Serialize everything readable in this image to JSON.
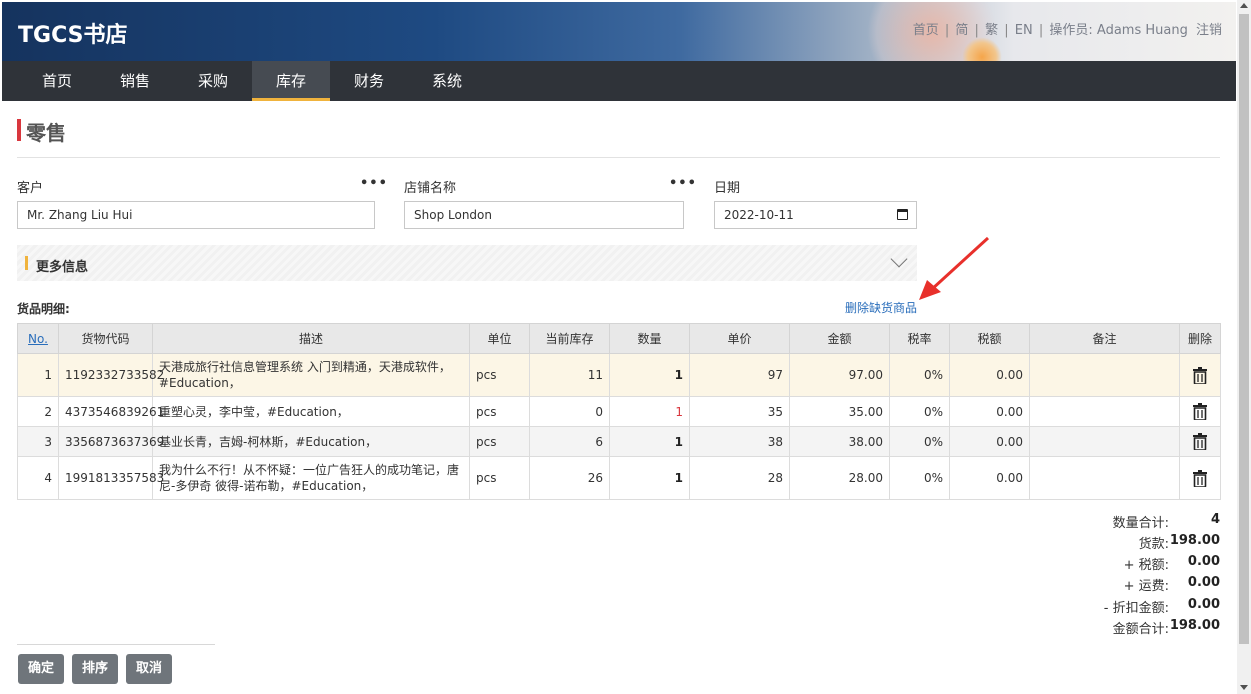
{
  "app": {
    "logo": "TGCS书店",
    "top_links": {
      "home": "首页",
      "simplified": "简",
      "traditional": "繁",
      "english": "EN",
      "operator_label": "操作员: ",
      "operator_name": "Adams Huang",
      "logout": "注销",
      "sep": "|"
    }
  },
  "nav": {
    "items": [
      "首页",
      "销售",
      "采购",
      "库存",
      "财务",
      "系统"
    ],
    "active": "库存"
  },
  "page": {
    "title": "零售"
  },
  "form": {
    "customer_label": "客户",
    "customer_value": "Mr. Zhang Liu Hui",
    "store_label": "店铺名称",
    "store_value": "Shop London",
    "date_label": "日期",
    "date_value": "2022-10-11",
    "more_info": "更多信息",
    "dots": "•••"
  },
  "goods": {
    "section_title": "货品明细:",
    "delete_out_of_stock": "删除缺货商品",
    "headers": {
      "no": "No.",
      "code": "货物代码",
      "desc": "描述",
      "unit": "单位",
      "stock": "当前库存",
      "qty": "数量",
      "price": "单价",
      "amount": "金额",
      "tax_rate": "税率",
      "tax": "税额",
      "note": "备注",
      "delete": "删除"
    },
    "rows": [
      {
        "no": "1",
        "code": "1192332733582",
        "desc": "天港成旅行社信息管理系统 入门到精通，天港成软件，#Education，",
        "unit": "pcs",
        "stock": "11",
        "qty": "1",
        "price": "97",
        "amount": "97.00",
        "tax_rate": "0%",
        "tax": "0.00",
        "note": ""
      },
      {
        "no": "2",
        "code": "4373546839261",
        "desc": "重塑心灵，李中莹，#Education，",
        "unit": "pcs",
        "stock": "0",
        "qty": "1",
        "price": "35",
        "amount": "35.00",
        "tax_rate": "0%",
        "tax": "0.00",
        "note": ""
      },
      {
        "no": "3",
        "code": "3356873637369",
        "desc": "基业长青，吉姆-柯林斯，#Education，",
        "unit": "pcs",
        "stock": "6",
        "qty": "1",
        "price": "38",
        "amount": "38.00",
        "tax_rate": "0%",
        "tax": "0.00",
        "note": ""
      },
      {
        "no": "4",
        "code": "1991813357583",
        "desc": "我为什么不行！从不怀疑：一位广告狂人的成功笔记，唐尼-多伊奇 彼得-诺布勒，#Education，",
        "unit": "pcs",
        "stock": "26",
        "qty": "1",
        "price": "28",
        "amount": "28.00",
        "tax_rate": "0%",
        "tax": "0.00",
        "note": ""
      }
    ]
  },
  "summary": {
    "qty_total_label": "数量合计:",
    "qty_total": "4",
    "goods_label": "货款:",
    "goods": "198.00",
    "tax_label": "+ 税额:",
    "tax": "0.00",
    "freight_label": "+ 运费:",
    "freight": "0.00",
    "discount_label": "- 折扣金额:",
    "discount": "0.00",
    "total_label": "金额合计:",
    "total": "198.00"
  },
  "buttons": {
    "confirm": "确定",
    "sort": "排序",
    "cancel": "取消"
  },
  "colors": {
    "accent_red": "#d9373e",
    "tab_underline": "#f0b33d",
    "link_blue": "#2a6ebb",
    "nav_bg": "#2f3339"
  }
}
